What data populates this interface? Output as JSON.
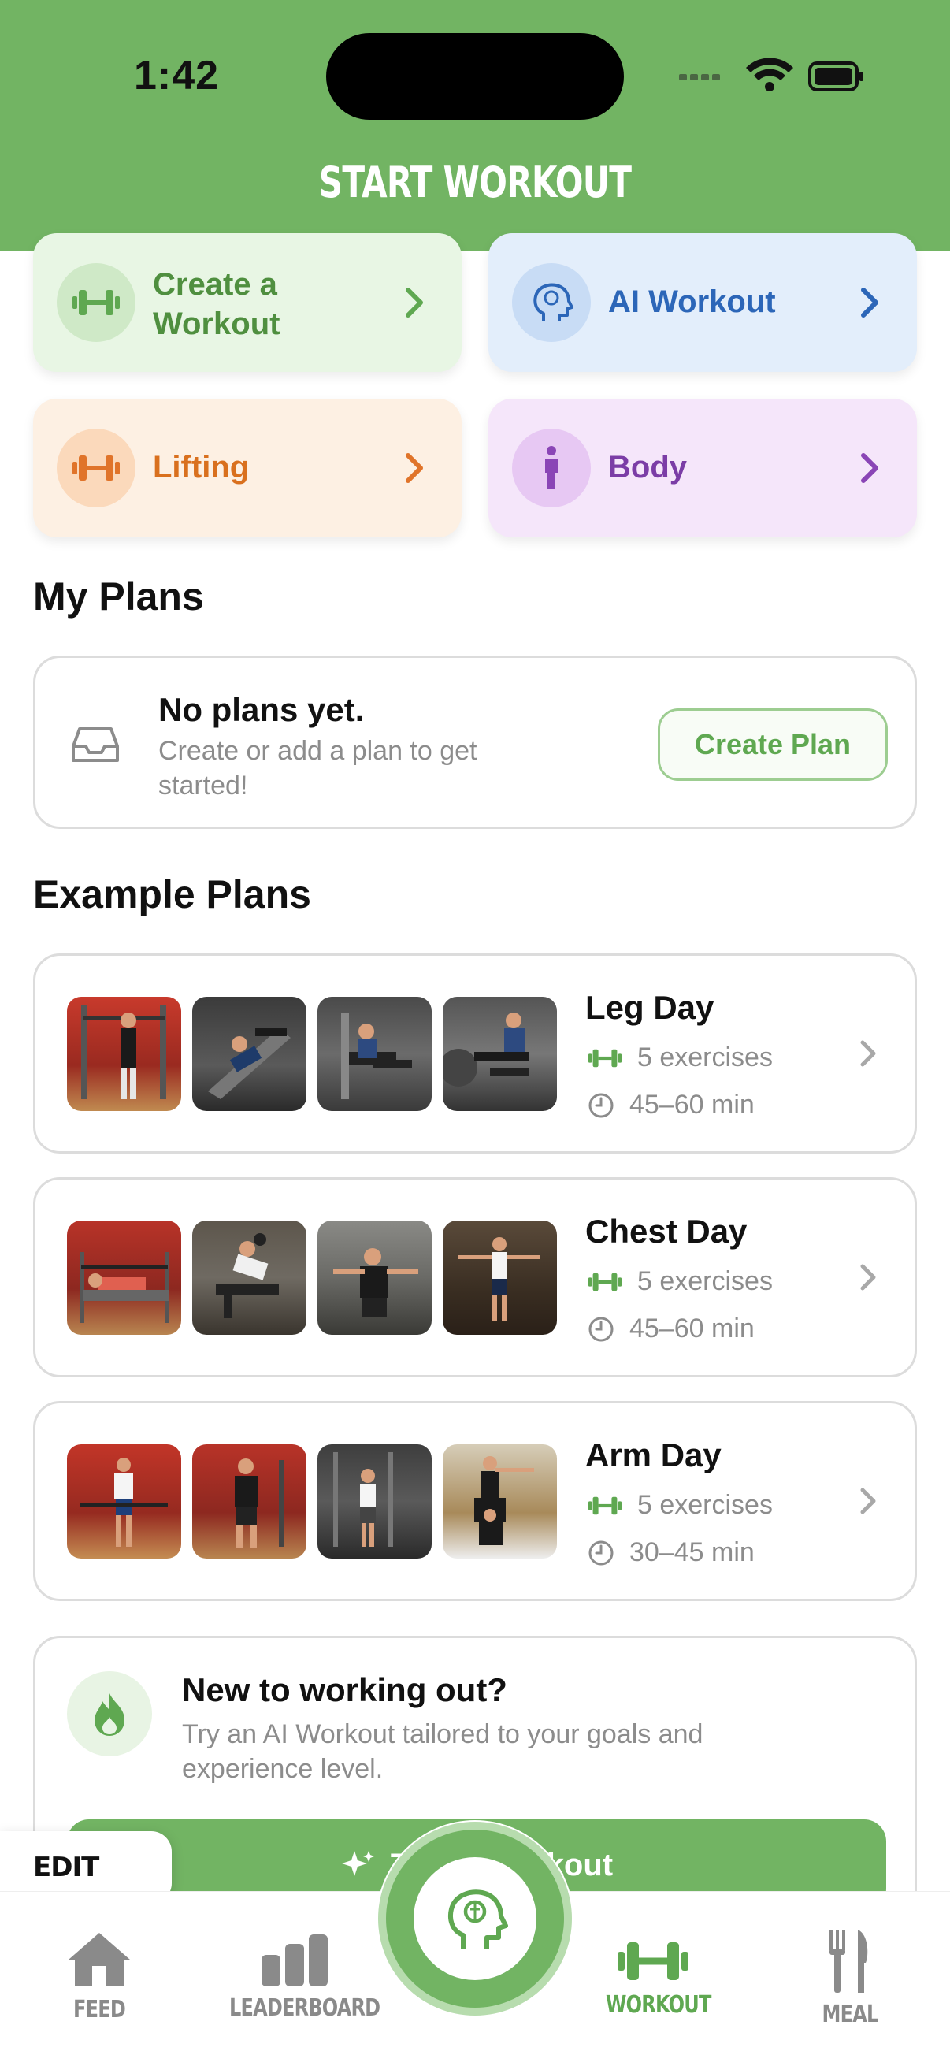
{
  "status": {
    "time": "1:42"
  },
  "header": {
    "title": "START WORKOUT"
  },
  "quick_actions": [
    {
      "label": "Create a Workout",
      "line1": "Create a",
      "line2": "Workout",
      "color": "#4f8f3f",
      "bg": "#e8f6e4"
    },
    {
      "label": "AI Workout",
      "color": "#2c66b8",
      "bg": "#e3eefb"
    },
    {
      "label": "Lifting",
      "color": "#d9701e",
      "bg": "#fdf0e3"
    },
    {
      "label": "Body",
      "color": "#7b3da6",
      "bg": "#f5e6fa"
    }
  ],
  "my_plans": {
    "title": "My Plans",
    "empty_title": "No plans yet.",
    "empty_subtitle": "Create or add a plan to get started!",
    "create_button": "Create Plan"
  },
  "example_plans": {
    "title": "Example Plans",
    "items": [
      {
        "name": "Leg Day",
        "exercises": "5 exercises",
        "duration": "45–60 min"
      },
      {
        "name": "Chest Day",
        "exercises": "5 exercises",
        "duration": "45–60 min"
      },
      {
        "name": "Arm Day",
        "exercises": "5 exercises",
        "duration": "30–45 min"
      }
    ]
  },
  "promo": {
    "title": "New to working out?",
    "subtitle": "Try an AI Workout tailored to your goals and experience level.",
    "button": "Try AI Workout"
  },
  "edit_tabs": "EDIT TABS",
  "tabs": [
    {
      "label": "FEED",
      "icon": "home-icon"
    },
    {
      "label": "LEADERBOARD",
      "icon": "leaderboard-icon"
    },
    {
      "label": "",
      "icon": "ai-brain-icon"
    },
    {
      "label": "WORKOUT",
      "icon": "dumbbell-icon",
      "active": true
    },
    {
      "label": "MEAL",
      "icon": "fork-knife-icon"
    }
  ],
  "colors": {
    "brand_green": "#72b463",
    "muted": "#8c8c8c"
  }
}
